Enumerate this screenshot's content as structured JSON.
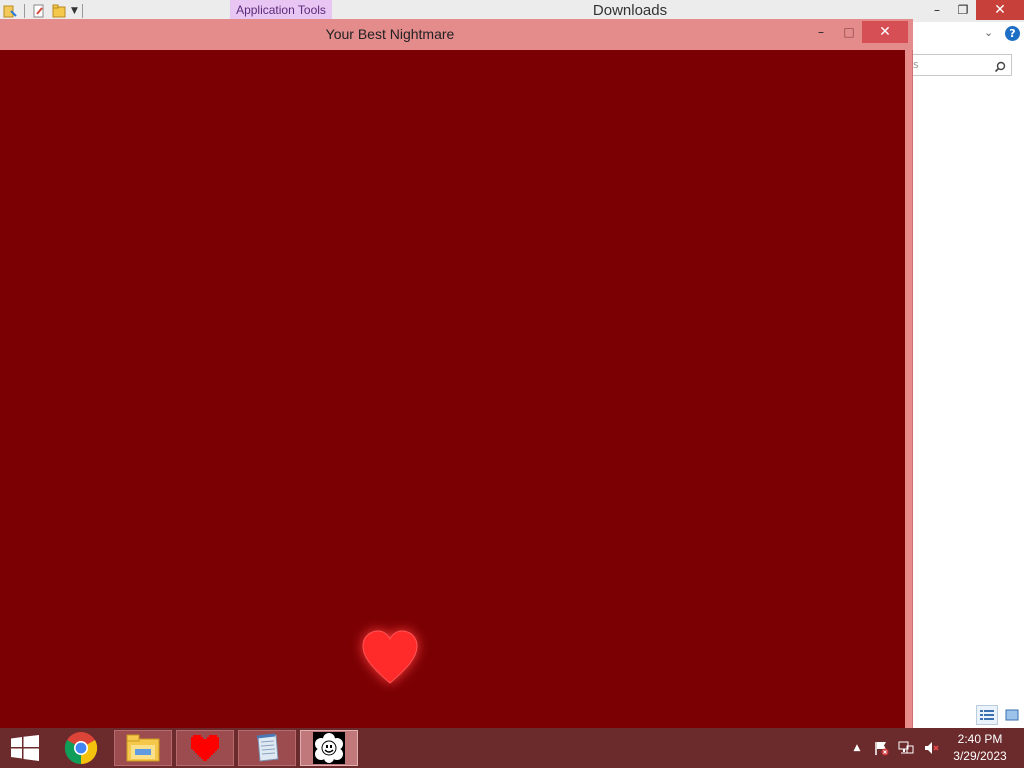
{
  "explorer": {
    "title": "Downloads",
    "ribbon_context_tab": "Application Tools",
    "controls": {
      "minimize": "–",
      "restore": "❐",
      "close": "✕"
    },
    "search_stub": "s",
    "help": "?"
  },
  "game_window": {
    "title": "Your Best Nightmare",
    "controls": {
      "minimize": "–",
      "maximize": "□",
      "close": "✕"
    },
    "background_color": "#7a0003",
    "heart_color": "#ff2a2a"
  },
  "taskbar": {
    "apps": [
      {
        "name": "Google Chrome",
        "icon": "chrome-icon"
      },
      {
        "name": "File Explorer",
        "icon": "folder-icon"
      },
      {
        "name": "Heart App",
        "icon": "heart-icon"
      },
      {
        "name": "Notepad",
        "icon": "notepad-icon"
      },
      {
        "name": "Flowey",
        "icon": "flowey-icon"
      }
    ],
    "clock": {
      "time": "2:40 PM",
      "date": "3/29/2023"
    }
  },
  "colors": {
    "game_titlebar": "#e48b8c",
    "taskbar": "#6b2a2c",
    "app_tools_tab": "#e8c6f3"
  }
}
